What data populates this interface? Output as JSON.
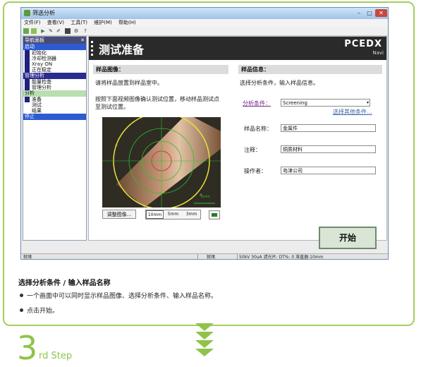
{
  "window": {
    "title": "筛选分析",
    "menu": [
      "文件(F)",
      "查看(V)",
      "工具(T)",
      "维护(M)",
      "帮助(H)"
    ]
  },
  "nav": {
    "header": "导航面板",
    "groups": [
      {
        "label": "启动",
        "items": [
          "初始化",
          "冷却检测器",
          "Xray ON",
          "正在稳定"
        ]
      },
      {
        "label": "管理分析",
        "items": [
          "能量检查",
          "管理分析"
        ]
      },
      {
        "label": "分析",
        "items": [
          "准备",
          "测试",
          "结果"
        ]
      },
      {
        "label": "停止",
        "items": []
      }
    ]
  },
  "banner": {
    "title": "测试准备",
    "brand": "PCEDX",
    "brand_sub": "Navi"
  },
  "sample_image": {
    "header": "样品图像：",
    "instruction1": "请将样品放置到样品室中。",
    "instruction2": "按照下面视频图像确认测试位置，移动样品测试点至测试位置。",
    "scale_label": "1mm",
    "adjust_button": "调整图像...",
    "zoom_options": [
      "10mm",
      "5mm",
      "3mm"
    ]
  },
  "sample_info": {
    "header": "样品信息：",
    "instruction": "选择分析条件，输入样品信息。",
    "condition_label": "分析条件：",
    "condition_value": "Screening",
    "other_condition_link": "选择其他条件...",
    "name_label": "样品名称：",
    "name_value": "金属件",
    "note_label": "注释：",
    "note_value": "铜质材料",
    "operator_label": "操作者：",
    "operator_value": "岛津公司"
  },
  "start_button": "开始",
  "statusbar": {
    "left": "就绪",
    "middle": "就绪",
    "right": "50kV  30uA  滤光片: DT%: 0  准直器:10mm"
  },
  "caption": {
    "title": "选择分析条件 / 输入样品名称",
    "bullets": [
      "一个画面中可以同时显示样品图像、选择分析条件、输入样品名称。",
      "点击开始。"
    ]
  },
  "step": {
    "number": "3",
    "label": "rd Step"
  },
  "colors": {
    "accent_green": "#8fc34a",
    "frame_green": "#a4cf5e",
    "banner": "#2a2a2a"
  }
}
